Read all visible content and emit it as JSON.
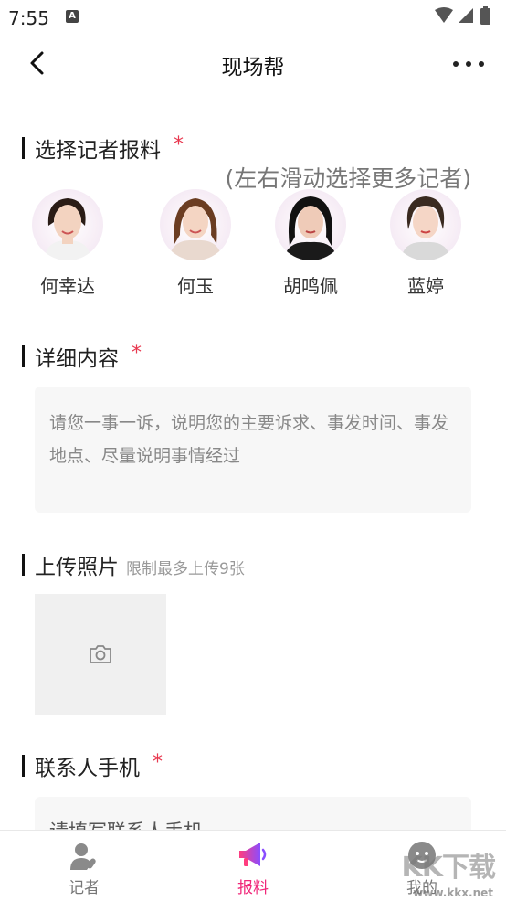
{
  "status_bar": {
    "time": "7:55",
    "badge": "A"
  },
  "navbar": {
    "title": "现场帮"
  },
  "reporter_section": {
    "title": "选择记者报料",
    "required_mark": "*",
    "swipe_hint": "(左右滑动选择更多记者)",
    "reporters": [
      {
        "name": "何幸达"
      },
      {
        "name": "何玉"
      },
      {
        "name": "胡鸣佩"
      },
      {
        "name": "蓝婷"
      }
    ]
  },
  "detail_section": {
    "title": "详细内容",
    "required_mark": "*",
    "placeholder": "请您一事一诉，说明您的主要诉求、事发时间、事发地点、尽量说明事情经过"
  },
  "photo_section": {
    "title": "上传照片",
    "hint": "限制最多上传9张"
  },
  "phone_section": {
    "title": "联系人手机",
    "required_mark": "*",
    "placeholder": "请填写联系人手机"
  },
  "tabbar": {
    "tabs": [
      {
        "label": "记者",
        "icon": "reporter-icon"
      },
      {
        "label": "报料",
        "icon": "megaphone-icon",
        "active": true
      },
      {
        "label": "我的",
        "icon": "profile-icon"
      }
    ]
  },
  "watermark": {
    "main": "KK下载",
    "sub": "www.kkx.net"
  },
  "colors": {
    "accent": "#f0287a",
    "required": "#e8384f"
  }
}
